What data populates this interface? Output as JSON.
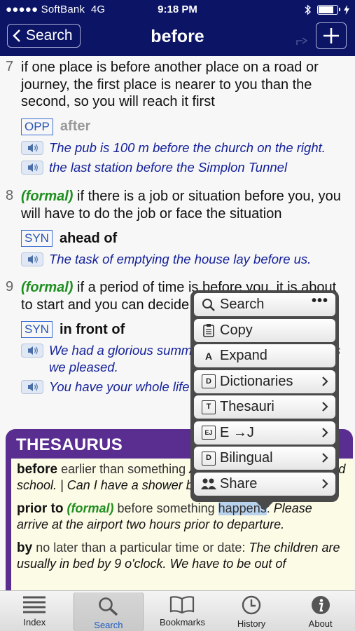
{
  "status": {
    "carrier": "●●●●● SoftBank",
    "network": "4G",
    "time": "9:18 PM",
    "battery_level": 0.85
  },
  "nav": {
    "back_label": "Search",
    "title": "before"
  },
  "senses": [
    {
      "num": "7",
      "definition": "if one place is before another place on a road or journey, the first place is nearer to you than the second, so you will reach it first",
      "xref": {
        "tag": "OPP",
        "word": "after"
      },
      "examples": [
        "The pub is 100 m before the church on the right.",
        "the last station before the Simplon Tunnel"
      ]
    },
    {
      "num": "8",
      "register": "(formal)",
      "definition": "if there is a job or situation before you, you will have to do the job or face the situation",
      "xref": {
        "tag": "SYN",
        "word": "ahead of"
      },
      "examples": [
        "The task of emptying the house lay before us."
      ]
    },
    {
      "num": "9",
      "register": "(formal)",
      "definition": "if a period of time is before you, it is about to start and you can decide what to do during it",
      "xref": {
        "tag": "SYN",
        "word": "in front of"
      },
      "examples": [
        "We had a glorious summer before us, free to do as we pleased.",
        "You have your whole life before you."
      ]
    }
  ],
  "thesaurus": {
    "header": "THESAURUS",
    "entries": [
      {
        "word": "before",
        "gloss": "earlier than something",
        "example": "Ann read before she started school. | Can I have a shower before me?"
      },
      {
        "word": "prior to",
        "register": "(formal)",
        "gloss_pre": "before something",
        "gloss_hl": "happens",
        "gloss_post": ":",
        "example": "Please arrive at the airport two hours prior to departure."
      },
      {
        "word": "by",
        "gloss": "no later than a particular time or date:",
        "example": "The children are usually in bed by 9 o'clock.",
        "example2": "We have to be out of"
      }
    ]
  },
  "popup_menu": {
    "items": [
      {
        "label": "Search",
        "icon": "search-icon",
        "more": "•••"
      },
      {
        "label": "Copy",
        "icon": "clipboard-icon"
      },
      {
        "label": "Expand",
        "icon": "expand-icon",
        "icon_text": "A"
      },
      {
        "label": "Dictionaries",
        "icon": "dictionary-icon",
        "icon_text": "D"
      },
      {
        "label": "Thesauri",
        "icon": "thesaurus-icon",
        "icon_text": "T"
      },
      {
        "label": "E →J",
        "icon": "ej-dictionary-icon",
        "icon_text": "EJ"
      },
      {
        "label": "Bilingual",
        "icon": "bilingual-icon",
        "icon_text": "D"
      },
      {
        "label": "Share",
        "icon": "people-icon"
      }
    ]
  },
  "tabs": [
    {
      "label": "Index",
      "icon": "list-icon"
    },
    {
      "label": "Search",
      "icon": "search-icon",
      "active": true
    },
    {
      "label": "Bookmarks",
      "icon": "book-icon"
    },
    {
      "label": "History",
      "icon": "clock-icon"
    },
    {
      "label": "About",
      "icon": "info-icon"
    }
  ]
}
